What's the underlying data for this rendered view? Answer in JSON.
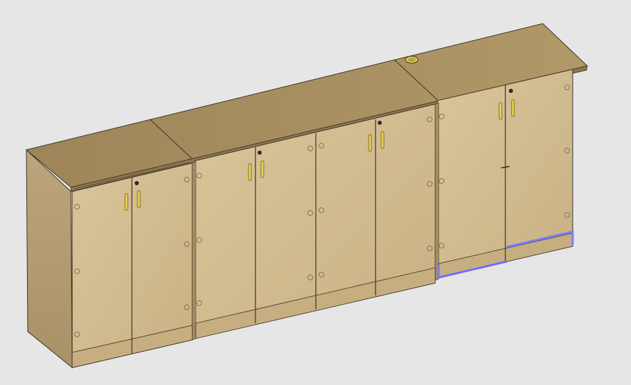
{
  "scene": {
    "subject": "cabinet-run-3d-render",
    "modules": [
      {
        "id": "cabinet-left",
        "doors": 2,
        "has_lock": true
      },
      {
        "id": "cabinet-middle",
        "doors": 4,
        "has_lock": true
      },
      {
        "id": "cabinet-right",
        "doors": 2,
        "has_lock": true,
        "selected_edge": true
      }
    ],
    "colors": {
      "background": "#e6e6e6",
      "wood_front": "#d2bc8f",
      "wood_top": "#a78e63",
      "wood_side": "#b6a074",
      "plinth": "#c9b385",
      "edge": "#3c3224",
      "handle": "#e8d24a",
      "grommet": "#e4d44a",
      "selection": "#7b7bff"
    },
    "icons": [
      "handle-icon",
      "lock-icon",
      "grommet-icon",
      "hinge-hole-icon"
    ]
  }
}
